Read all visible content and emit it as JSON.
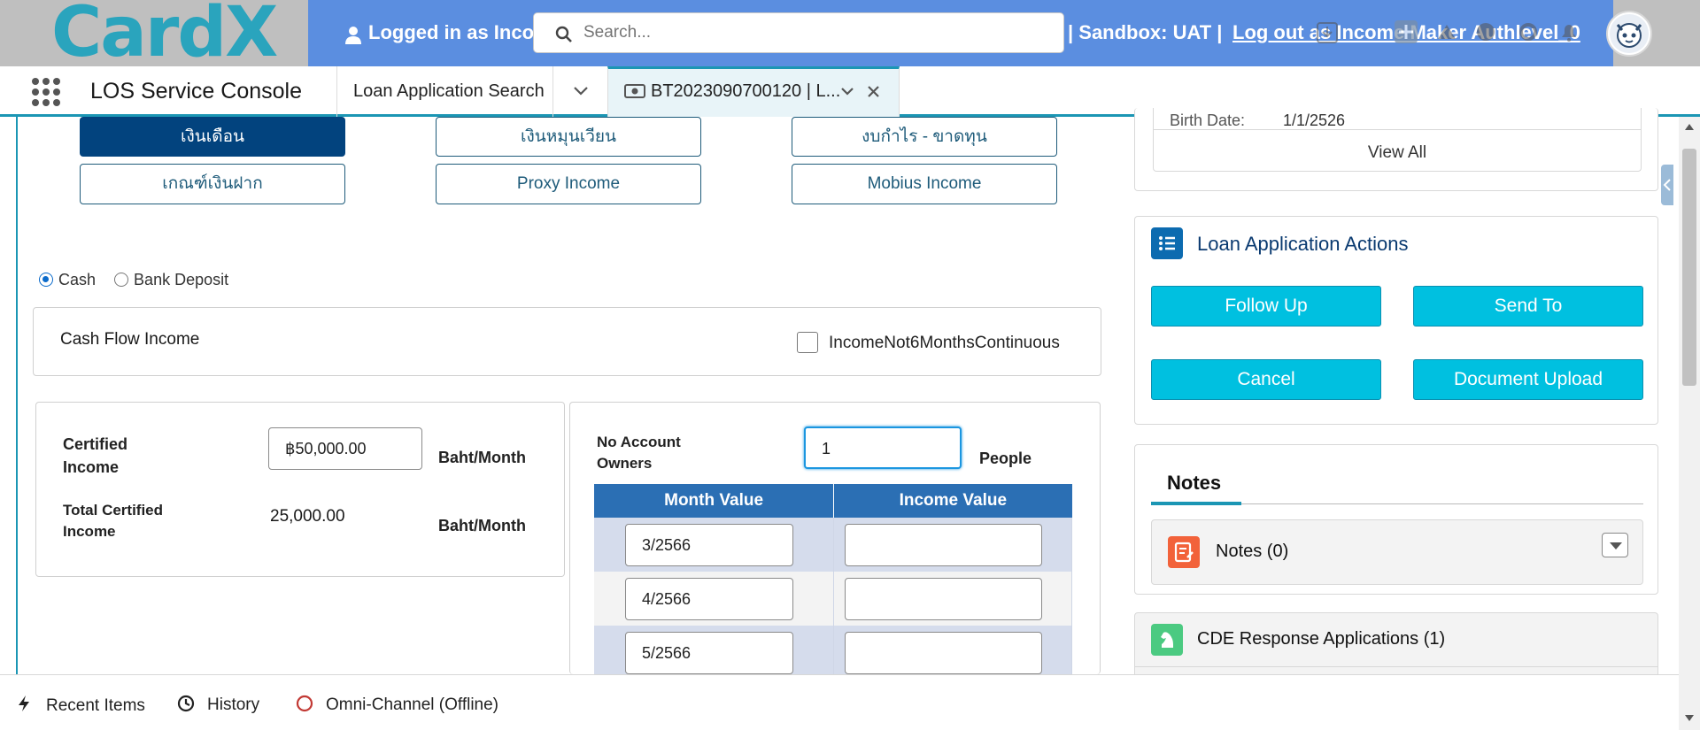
{
  "banner": {
    "logo": "CardX",
    "logged_in": "Logged in as Inco",
    "sandbox": "| Sandbox: UAT |",
    "logout": "Log out as Income Maker Authlevel_0",
    "search_placeholder": "Search..."
  },
  "nav": {
    "app_name": "LOS Service Console",
    "tabs": [
      {
        "label": "Loan Application Search"
      },
      {
        "label": "BT2023090700120 | L..."
      }
    ]
  },
  "income_buttons": [
    "เงินเดือน",
    "เงินหมุนเวียน",
    "งบกำไร - ขาดทุน",
    "เกณฑ์เงินฝาก",
    "Proxy Income",
    "Mobius Income"
  ],
  "income_type": {
    "options": [
      "Cash",
      "Bank Deposit"
    ],
    "selected": "Cash"
  },
  "cash_flow": {
    "title": "Cash Flow Income",
    "checkbox_label": "IncomeNot6MonthsContinuous"
  },
  "certified": {
    "certified_label": "Certified Income",
    "certified_value": "฿50,000.00",
    "unit": "Baht/Month",
    "total_label": "Total Certified Income",
    "total_value": "25,000.00"
  },
  "account_owners": {
    "label": "No Account Owners",
    "value": "1",
    "unit": "People"
  },
  "month_table": {
    "headers": [
      "Month Value",
      "Income Value"
    ],
    "rows": [
      {
        "month": "3/2566",
        "income": ""
      },
      {
        "month": "4/2566",
        "income": ""
      },
      {
        "month": "5/2566",
        "income": ""
      }
    ]
  },
  "customer_card": {
    "birth_label": "Birth Date:",
    "birth_value": "1/1/2526",
    "view_all": "View All"
  },
  "actions": {
    "title": "Loan Application Actions",
    "buttons": [
      "Follow Up",
      "Send To",
      "Cancel",
      "Document Upload"
    ]
  },
  "notes": {
    "tab": "Notes",
    "item": "Notes (0)"
  },
  "cde": {
    "title": "CDE Response Applications (1)"
  },
  "utility": {
    "recent": "Recent Items",
    "history": "History",
    "omni": "Omni-Channel (Offline)"
  },
  "colors": {
    "brand": "#1b96b4",
    "action": "#00c0e0",
    "selected": "#02437e",
    "table_header": "#2b6fb4"
  }
}
